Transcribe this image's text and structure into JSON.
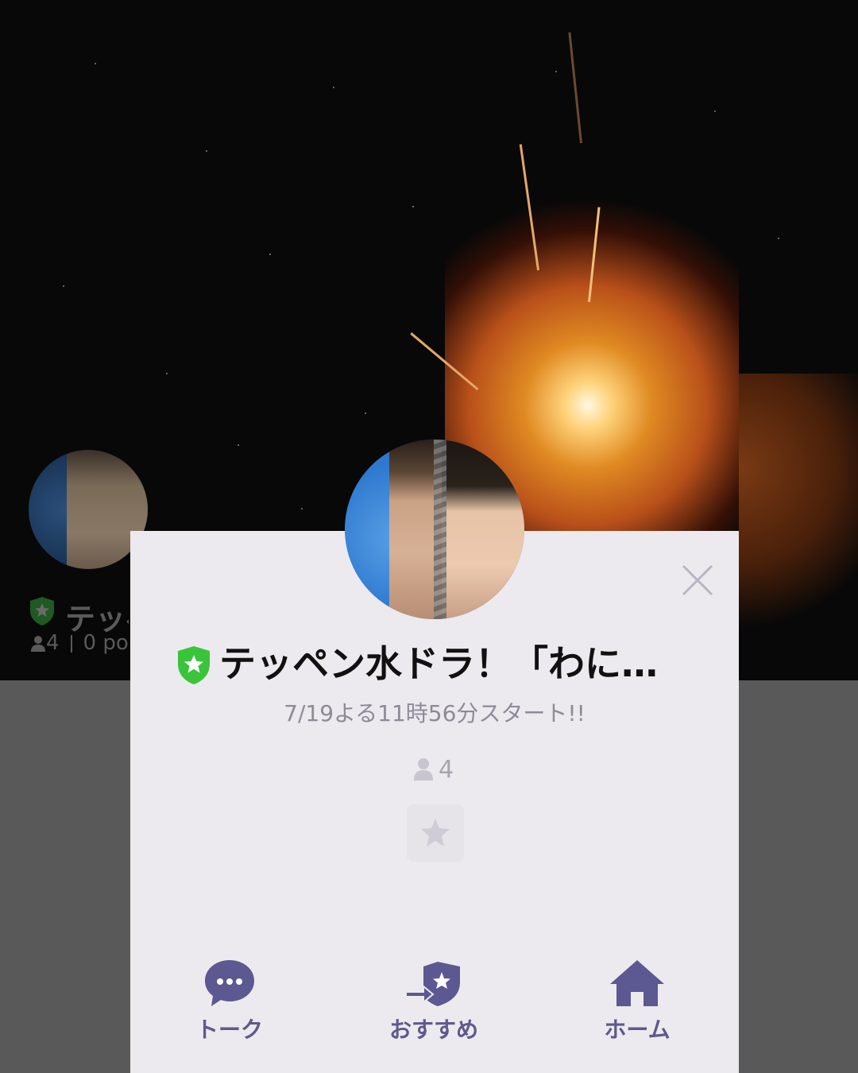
{
  "colors": {
    "accent_purple": "#5f5a8a",
    "icon_purple": "#5c5891",
    "badge_green": "#39c43a",
    "card_bg": "#eceaee",
    "muted_text": "#8e8a98"
  },
  "background_profile": {
    "title": "テッペン水ドラ！「わに…",
    "members": "4",
    "points": "0 po"
  },
  "profile": {
    "name": "テッペン水ドラ！「わに…",
    "status_message": "7/19よる11時56分スタート!!",
    "member_count": "4",
    "badge_icon": "official-shield-star-icon"
  },
  "nav": {
    "talk_label": "トーク",
    "recommend_label": "おすすめ",
    "home_label": "ホーム"
  }
}
